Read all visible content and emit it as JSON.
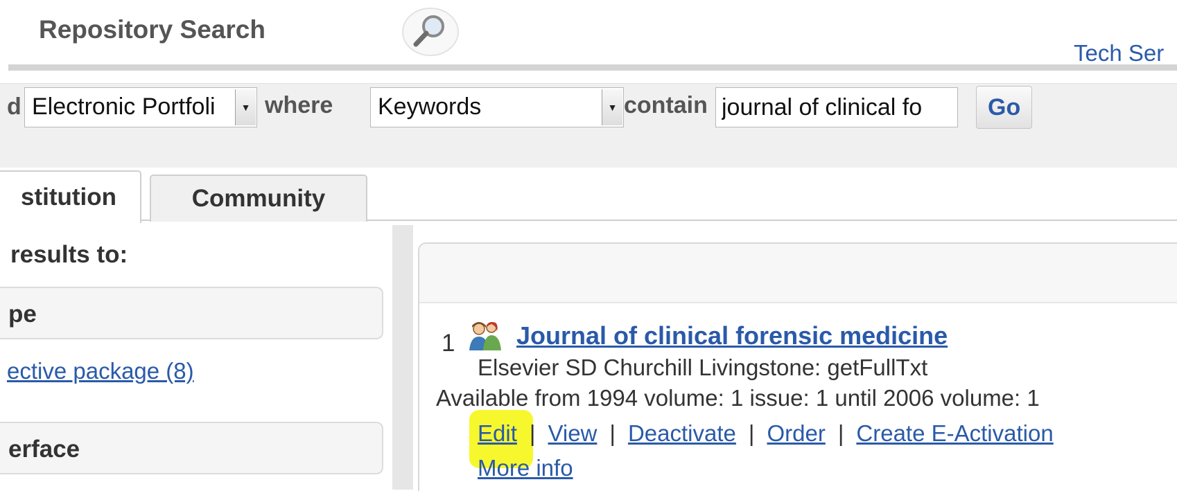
{
  "header": {
    "title": "Repository Search",
    "tech_link": "Tech Ser"
  },
  "search_row": {
    "prefix": "d",
    "type_select": "Electronic Portfoli",
    "where_label": "where",
    "field_select": "Keywords",
    "contains_label": "contain",
    "query_value": "journal of clinical fo",
    "go_label": "Go"
  },
  "tabs": [
    {
      "label": "stitution",
      "active": true
    },
    {
      "label": "Community",
      "active": false
    }
  ],
  "facets": {
    "title": "results to:",
    "groups": [
      {
        "label": "pe",
        "links": [
          "ective package (8)"
        ]
      },
      {
        "label": "erface",
        "links": []
      }
    ]
  },
  "results": [
    {
      "number": "1",
      "title": "Journal of clinical forensic medicine",
      "provider": "Elsevier SD Churchill Livingstone: getFullTxt",
      "availability": "Available from 1994 volume: 1 issue: 1 until 2006 volume: 1",
      "actions": [
        "Edit",
        "View",
        "Deactivate",
        "Order",
        "Create E-Activation"
      ],
      "more_info": "More info"
    }
  ],
  "colors": {
    "link": "#2a5aa8",
    "highlight": "#f7f72e",
    "panel_bg": "#f0f0f0"
  },
  "icons": {
    "search": "magnifier-icon",
    "result_type": "people-group-icon"
  }
}
